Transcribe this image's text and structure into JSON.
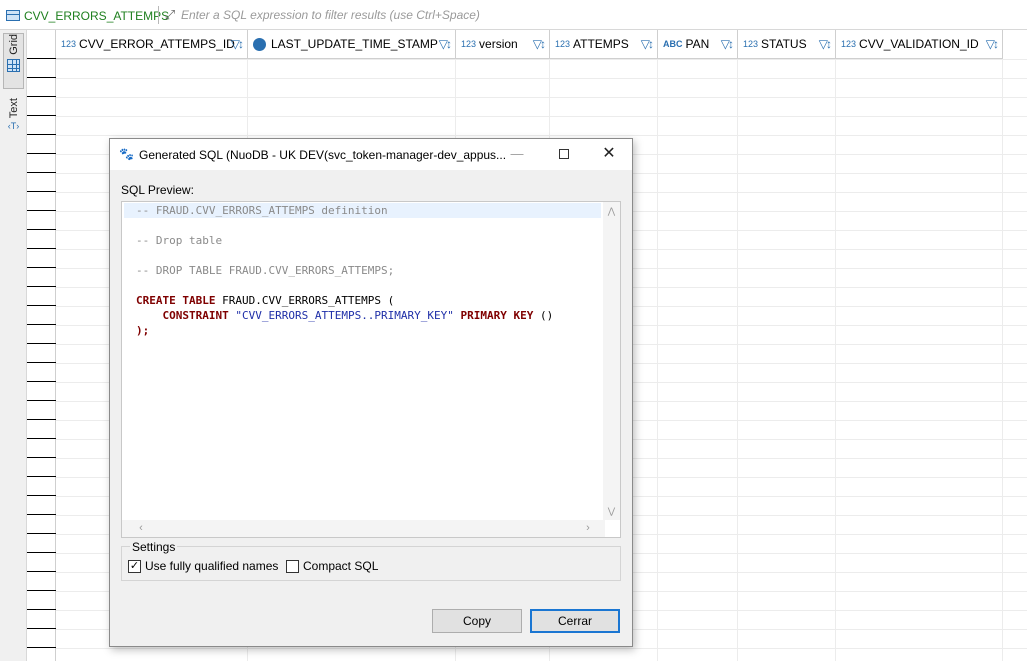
{
  "filter_bar": {
    "table_name": "CVV_ERRORS_ATTEMPS",
    "filter_placeholder": "Enter a SQL expression to filter results (use Ctrl+Space)",
    "expand_icon": "expand-icon"
  },
  "side_tabs": {
    "grid_label": "Grid",
    "text_label": "Text",
    "text_icon_glyph": "‹T›"
  },
  "columns": [
    {
      "type_glyph": "123",
      "type": "number",
      "name": "CVV_ERROR_ATTEMPS_ID"
    },
    {
      "type_glyph": "",
      "type": "datetime",
      "name": "LAST_UPDATE_TIME_STAMP"
    },
    {
      "type_glyph": "123",
      "type": "number",
      "name": "version"
    },
    {
      "type_glyph": "123",
      "type": "number",
      "name": "ATTEMPS"
    },
    {
      "type_glyph": "ABC",
      "type": "string",
      "name": "PAN"
    },
    {
      "type_glyph": "123",
      "type": "number",
      "name": "STATUS"
    },
    {
      "type_glyph": "123",
      "type": "number",
      "name": "CVV_VALIDATION_ID"
    }
  ],
  "dialog": {
    "title": "Generated SQL (NuoDB - UK DEV(svc_token-manager-dev_appus...",
    "minimize_glyph": "—",
    "close_glyph": "✕",
    "sql_preview_label": "SQL Preview:",
    "sql_lines": [
      {
        "text": "-- FRAUD.CVV_ERRORS_ATTEMPS definition",
        "kind": "comment"
      },
      {
        "text": "",
        "kind": "blank"
      },
      {
        "text": "-- Drop table",
        "kind": "comment"
      },
      {
        "text": "",
        "kind": "blank"
      },
      {
        "text": "-- DROP TABLE FRAUD.CVV_ERRORS_ATTEMPS;",
        "kind": "comment"
      },
      {
        "text": "",
        "kind": "blank"
      },
      {
        "segments": [
          {
            "t": "CREATE TABLE",
            "c": "kw"
          },
          {
            "t": " FRAUD.CVV_ERRORS_ATTEMPS (",
            "c": ""
          }
        ]
      },
      {
        "segments": [
          {
            "t": "    ",
            "c": ""
          },
          {
            "t": "CONSTRAINT",
            "c": "kw"
          },
          {
            "t": " ",
            "c": ""
          },
          {
            "t": "\"CVV_ERRORS_ATTEMPS..PRIMARY_KEY\"",
            "c": "str"
          },
          {
            "t": " ",
            "c": ""
          },
          {
            "t": "PRIMARY KEY",
            "c": "kw"
          },
          {
            "t": " ()",
            "c": ""
          }
        ]
      },
      {
        "segments": [
          {
            "t": ");",
            "c": "kw"
          }
        ]
      }
    ],
    "settings_label": "Settings",
    "use_fully_qualified_label": "Use fully qualified names",
    "use_fully_qualified_checked": true,
    "compact_sql_label": "Compact SQL",
    "compact_sql_checked": false,
    "copy_button": "Copy",
    "close_button": "Cerrar"
  },
  "colors": {
    "table_name_green": "#1e7f1e",
    "sql_keyword": "#7f0000",
    "sql_string": "#1f2fa8",
    "sql_comment": "#8a8a8a",
    "default_button_border": "#1a76d2"
  }
}
